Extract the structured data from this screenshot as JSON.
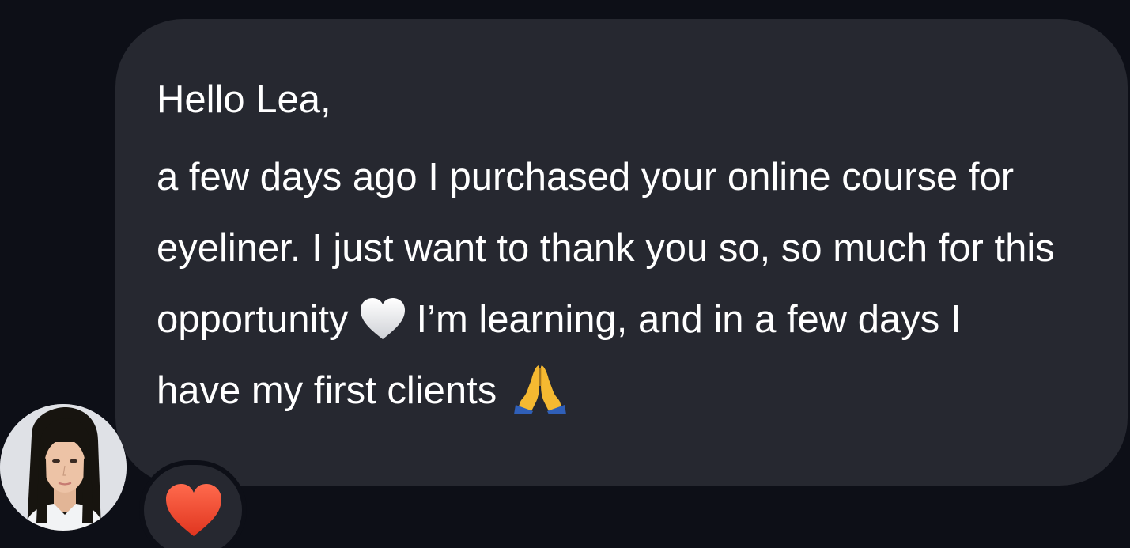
{
  "message": {
    "greeting": "Hello Lea,",
    "lines": [
      "a few days ago I purchased your online course for",
      "eyeliner. I just want to thank you so, so much for this",
      "opportunity",
      "I’m learning, and in a few days I",
      "have my first clients"
    ],
    "inline_icons": [
      "white-heart-icon",
      "folded-hands-icon"
    ]
  },
  "reaction": {
    "icon": "red-heart-icon",
    "color": "#e8412e"
  },
  "colors": {
    "background": "#0d0f17",
    "bubble": "#262830",
    "text": "#ffffff"
  }
}
